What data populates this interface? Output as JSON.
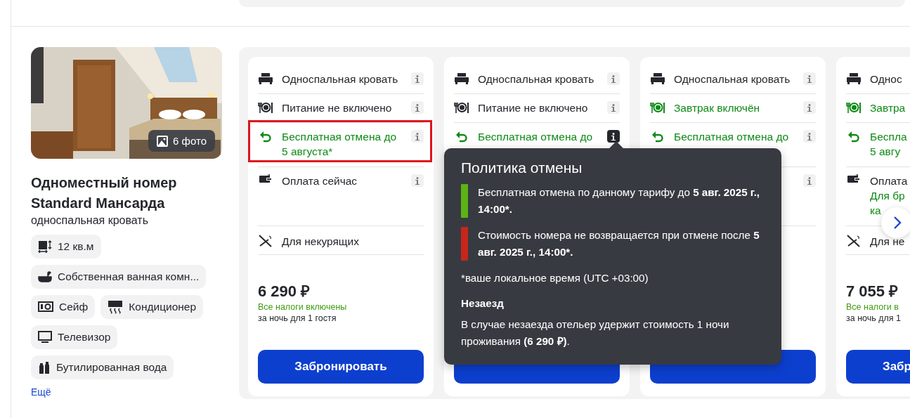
{
  "room": {
    "photo": {
      "kind": "picture",
      "badge": "6 фото"
    },
    "title": "Одноместный номер Standard Мансарда",
    "subtitle": "односпальная кровать",
    "amenities": [
      {
        "kind": "area",
        "label": "12 кв.м"
      },
      {
        "kind": "bath",
        "label": "Собственная ванная комн..."
      },
      {
        "kind": "safe",
        "label": "Сейф"
      },
      {
        "kind": "ac",
        "label": "Кондиционер"
      },
      {
        "kind": "tv",
        "label": "Телевизор"
      },
      {
        "kind": "water",
        "label": "Бутилированная вода"
      }
    ],
    "more_link": "Ещё"
  },
  "rates": [
    {
      "rows": [
        {
          "kind": "bed",
          "lines": [
            "Односпальная кровать"
          ],
          "positive": false,
          "info": true,
          "info_active": false,
          "highlighted": false
        },
        {
          "kind": "meal",
          "lines": [
            "Питание не включено"
          ],
          "positive": false,
          "info": true,
          "info_active": false,
          "highlighted": false
        },
        {
          "kind": "cancel",
          "lines": [
            "Бесплатная отмена до",
            "5 августа*"
          ],
          "positive": true,
          "info": true,
          "info_active": false,
          "highlighted": true
        },
        {
          "kind": "payment",
          "lines": [
            "Оплата сейчас"
          ],
          "positive": false,
          "info": true,
          "info_active": false,
          "highlighted": false
        },
        {
          "kind": "smoking",
          "lines": [
            "Для некурящих"
          ],
          "positive": false,
          "info": false,
          "highlighted": false
        }
      ],
      "price": "6 290 ₽",
      "taxes": "Все налоги включены",
      "per_night": "за ночь для 1 гостя",
      "book_label": "Забронировать"
    },
    {
      "rows": [
        {
          "kind": "bed",
          "lines": [
            "Односпальная кровать"
          ],
          "positive": false,
          "info": true,
          "info_active": false,
          "highlighted": false
        },
        {
          "kind": "meal",
          "lines": [
            "Питание не включено"
          ],
          "positive": false,
          "info": true,
          "info_active": false,
          "highlighted": false
        },
        {
          "kind": "cancel",
          "lines": [
            "Бесплатная отмена до"
          ],
          "positive": true,
          "info": true,
          "info_active": true,
          "highlighted": false
        }
      ]
    },
    {
      "rows": [
        {
          "kind": "bed",
          "lines": [
            "Односпальная кровать"
          ],
          "positive": false,
          "info": true,
          "info_active": false,
          "highlighted": false
        },
        {
          "kind": "meal",
          "lines": [
            "Завтрак включён"
          ],
          "positive": true,
          "info": true,
          "info_active": false,
          "highlighted": false
        },
        {
          "kind": "cancel",
          "lines": [
            "Бесплатная отмена до"
          ],
          "positive": true,
          "info": true,
          "info_active": false,
          "highlighted": false
        },
        {
          "info": true,
          "info_active": false
        }
      ]
    },
    {
      "rows": [
        {
          "kind": "bed",
          "lines": [
            "Однос"
          ],
          "positive": false,
          "info": false,
          "highlighted": false
        },
        {
          "kind": "meal",
          "lines": [
            "Завтра"
          ],
          "positive": true,
          "info": false,
          "highlighted": false
        },
        {
          "kind": "cancel",
          "lines": [
            "Беспла",
            "5 авгу"
          ],
          "positive": true,
          "info": false,
          "highlighted": false
        },
        {
          "kind": "payment",
          "lines": [
            "Оплата"
          ],
          "note": [
            "Для бр",
            "ка"
          ],
          "positive": false,
          "info": false,
          "highlighted": false
        },
        {
          "kind": "smoking",
          "lines": [
            "Для не"
          ],
          "positive": false,
          "info": false,
          "highlighted": false
        }
      ],
      "price": "7 055 ₽",
      "taxes": "Все налоги в",
      "per_night": "за ночь для 1",
      "book_label": "Забр"
    }
  ],
  "tooltip": {
    "title": "Политика отмены",
    "items": [
      {
        "color": "#5bb414",
        "text": "Бесплатная отмена по данному тарифу до **5 авг. 2025 г., 14:00*.**"
      },
      {
        "color": "#c8261a",
        "text": "Стоимость номера не возвращается при отмене после **5 авг. 2025 г., 14:00*.**"
      }
    ],
    "footnote": "*ваше локальное время (UTC +03:00)",
    "no_show_title": "Незаезд",
    "no_show_text": "В случае незаезда отельер удержит стоимость 1 ночи проживания **(6 290 ₽)**."
  }
}
